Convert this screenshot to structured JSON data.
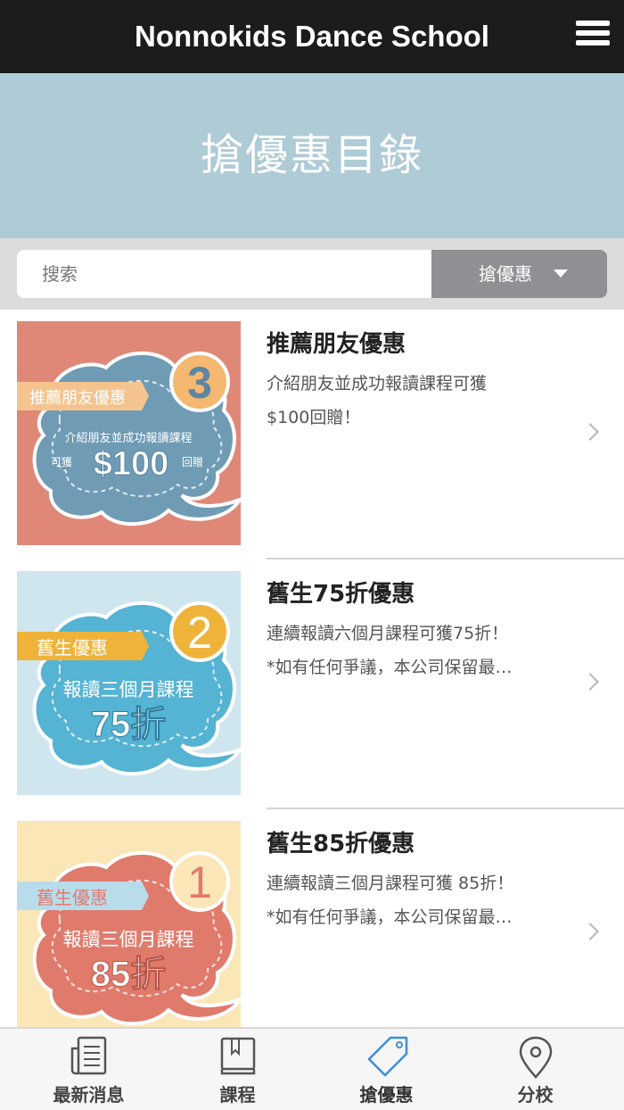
{
  "header": {
    "title": "Nonnokids Dance School",
    "menu_icon": "menu-icon"
  },
  "banner": {
    "heading": "搶優惠目錄"
  },
  "search": {
    "placeholder": "搜索",
    "category": "搶優惠"
  },
  "offers": [
    {
      "title": "推薦朋友優惠",
      "desc_lines": [
        "介紹朋友並成功報讀課程可獲",
        "$100回贈！"
      ],
      "image": {
        "number": "3",
        "tag": "推薦朋友優惠",
        "line1": "介紹朋友並成功報讀課程",
        "line2_pre": "可獲",
        "big": "$100",
        "line2_post": "回贈",
        "bg": "#e08878",
        "cloud": "#6f9bb5",
        "badge": "#f5b870",
        "tag_bg": "#f5c48e"
      }
    },
    {
      "title": "舊生75折優惠",
      "desc_lines": [
        "連續報讀六個月課程可獲75折！",
        "*如有任何爭議，本公司保留最…"
      ],
      "image": {
        "number": "2",
        "tag": "舊生優惠",
        "line1": "報讀三個月課程",
        "big": "75折",
        "bg": "#cfe6ef",
        "cloud": "#55b3d3",
        "badge": "#f0b33a",
        "tag_bg": "#f0b33a"
      }
    },
    {
      "title": "舊生85折優惠",
      "desc_lines": [
        "連續報讀三個月課程可獲 85折！",
        "*如有任何爭議，本公司保留最…"
      ],
      "image": {
        "number": "1",
        "tag": "舊生優惠",
        "line1": "報讀三個月課程",
        "big": "85折",
        "bg": "#fbe6b8",
        "cloud": "#e07b6c",
        "badge": "#fbe6b8",
        "tag_bg": "#b9dceb"
      }
    }
  ],
  "tabs": [
    {
      "label": "最新消息",
      "icon": "news-icon",
      "active": false
    },
    {
      "label": "課程",
      "icon": "book-icon",
      "active": false
    },
    {
      "label": "搶優惠",
      "icon": "tag-icon",
      "active": true
    },
    {
      "label": "分校",
      "icon": "location-pin-icon",
      "active": false
    }
  ],
  "colors": {
    "header_bg": "#1c1c1c",
    "banner_bg": "#aecbd6",
    "active_tab": "#3d8fd8",
    "tab_icon": "#555555"
  }
}
